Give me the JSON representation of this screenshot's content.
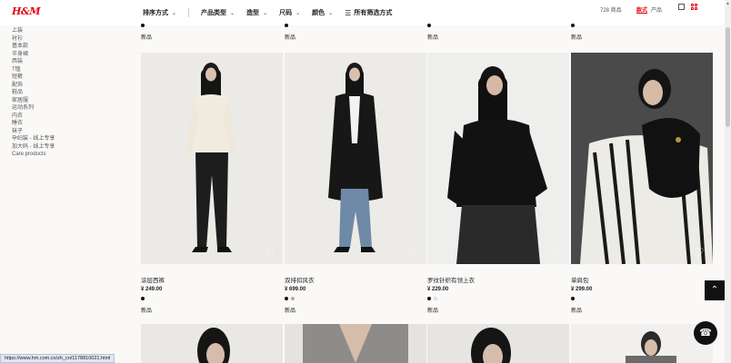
{
  "brand": {
    "logo": "H&M"
  },
  "toolbar": {
    "filters": [
      {
        "label": "排序方式"
      },
      {
        "label": "产品类型"
      },
      {
        "label": "造型"
      },
      {
        "label": "尺码"
      },
      {
        "label": "颜色"
      }
    ],
    "all_filters": "所有筛选方式",
    "count": "728 商品",
    "view_model": "款式",
    "view_product": "产品"
  },
  "sidebar": {
    "items": [
      "上装",
      "衬衫",
      "基本款",
      "半身裙",
      "西装",
      "T恤",
      "短裤",
      "配饰",
      "鞋品",
      "家居服",
      "运动系列",
      "内衣",
      "睡衣",
      "袜子",
      "孕妇装 - 线上专享",
      "加大码 - 线上专享",
      "Care products"
    ]
  },
  "top_row": {
    "tag": "新品"
  },
  "products": [
    {
      "name": "涂层西裤",
      "price": "¥ 249.00",
      "swatches": [
        "#111111"
      ],
      "tag": "新品"
    },
    {
      "name": "双排扣风衣",
      "price": "¥ 699.00",
      "swatches": [
        "#111111",
        "#c9a77c"
      ],
      "tag": "新品"
    },
    {
      "name": "罗纹针织有领上衣",
      "price": "¥ 229.00",
      "swatches": [
        "#111111",
        "#dddddd"
      ],
      "tag": "新品"
    },
    {
      "name": "单肩包",
      "price": "¥ 299.00",
      "swatches": [
        "#111111"
      ],
      "tag": "新品"
    }
  ],
  "status_url": "https://www.hm.com.cn/zh_cn/1178810021.html",
  "colors": {
    "brand_red": "#e50010"
  }
}
